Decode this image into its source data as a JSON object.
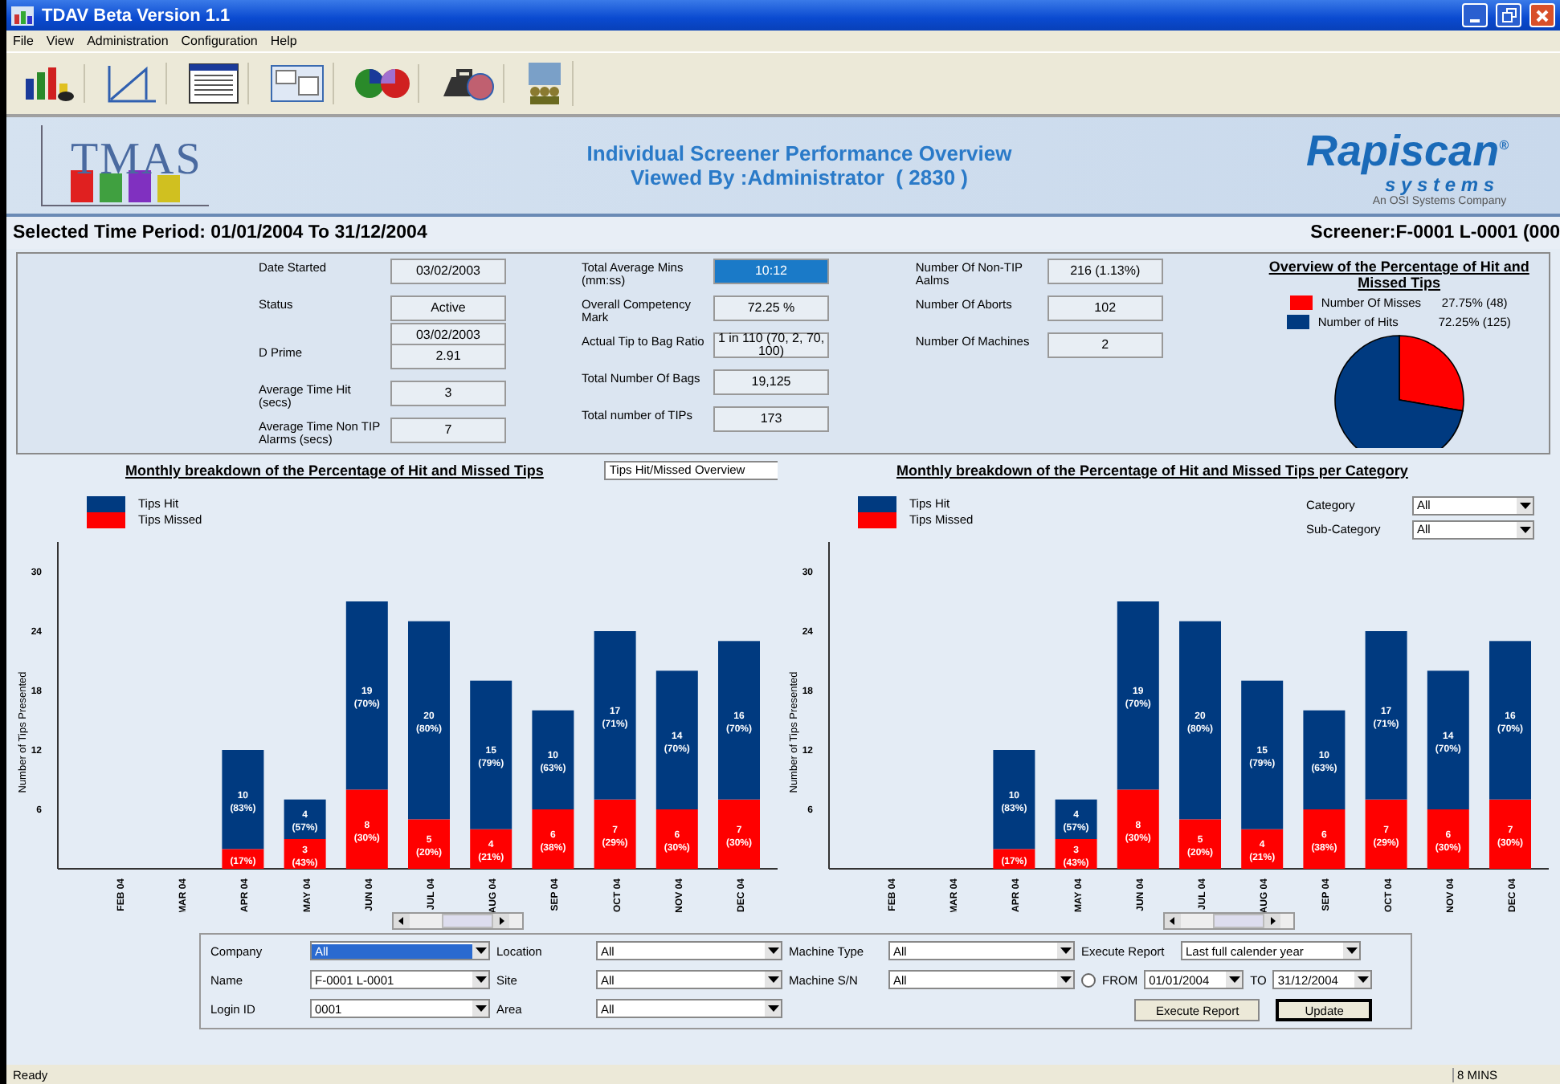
{
  "window": {
    "title": "TDAV Beta Version 1.1"
  },
  "menu": [
    "File",
    "View",
    "Administration",
    "Configuration",
    "Help"
  ],
  "banner": {
    "logo_text": "TMAS",
    "title_lines": [
      "Individual Screener Performance Overview",
      "Viewed By :Administrator  ( 2830 )"
    ],
    "brand": "Rapiscan$^{®}$",
    "brand_sub": "s y s t e m s",
    "brand_tagline": "An OSI Systems Company"
  },
  "period": "Selected Time Period: 01/01/2004 To 31/12/2004",
  "screener": "Screener:F-0001 L-0001 (000",
  "stats": [
    [
      {
        "label": "Date Started",
        "values": [
          "03/02/2003"
        ],
        "focused": false
      },
      {
        "label": "Status",
        "values": [
          "Active",
          "03/02/2003"
        ],
        "focused": false
      },
      {
        "label": "D Prime",
        "values": [
          "2.91"
        ],
        "focused": false
      },
      {
        "label": "Average Time Hit (secs)",
        "values": [
          "3"
        ],
        "focused": false
      },
      {
        "label": "Average Time Non TIP Alarms (secs)",
        "values": [
          "7"
        ],
        "focused": false
      }
    ],
    [
      {
        "label": "Total Average Mins (mm:ss)",
        "values": [
          "10:12"
        ],
        "focused": true
      },
      {
        "label": "Overall Competency Mark",
        "values": [
          "72.25 %"
        ],
        "focused": false
      },
      {
        "label": "Actual Tip to Bag Ratio",
        "values": [
          "1 in 110 (70, 2, 70, 100)"
        ],
        "focused": false
      },
      {
        "label": "Total Number Of Bags",
        "values": [
          "19,125"
        ],
        "focused": false
      },
      {
        "label": "Total number of TIPs",
        "values": [
          "173"
        ],
        "focused": false
      }
    ],
    [
      {
        "label": "Number Of Non-TIP Aalms",
        "values": [
          "216 (1.13%)"
        ],
        "focused": false
      },
      {
        "label": "Number Of Aborts",
        "values": [
          "102"
        ],
        "focused": false
      },
      {
        "label": "Number Of Machines",
        "values": [
          "2"
        ],
        "focused": false
      }
    ]
  ],
  "overview": {
    "title": "Overview of the Percentage of Hit and Missed Tips",
    "legend": [
      {
        "value": "27.75% (48)",
        "color": "#ff0000"
      },
      {
        "value": "72.25% (125)",
        "color": "#003a80"
      }
    ],
    "chart_data": {
      "type": "pie",
      "categories": [
        "Number Of Misses",
        "Number of Hits"
      ],
      "values": [
        27.75,
        72.25
      ]
    }
  },
  "charts": [
    {
      "title": "Monthly breakdown of the Percentage of Hit and Missed Tips",
      "controls": [
        {
          "kind": "select",
          "value": "Tips Hit/Missed Overview"
        }
      ],
      "bar_labels": [
        [
          "(17%)",
          "3 (43%)",
          "8 (30%)",
          "5 (20%)",
          "4 (21%)",
          "6 (38%)",
          "7 (29%)",
          "6 (30%)",
          "7 (30%)"
        ],
        [
          "10 (83%)",
          "4 (57%)",
          "19 (70%)",
          "20 (80%)",
          "15 (79%)",
          "10 (63%)",
          "17 (71%)",
          "14 (70%)",
          "16 (70%)"
        ]
      ],
      "chart_data": {
        "type": "bar",
        "stacked": true,
        "ylabel": "Number of Tips Presented",
        "categories": [
          "FEB 04",
          "MAR 04",
          "APR 04",
          "MAY 04",
          "JUN 04",
          "JUL 04",
          "AUG 04",
          "SEP 04",
          "OCT 04",
          "NOV 04",
          "DEC 04"
        ],
        "yticks": [
          6,
          12,
          18,
          24,
          30
        ],
        "ylim": [
          0,
          33
        ],
        "series": [
          {
            "name": "Tips Missed",
            "color": "#ff0000",
            "values": [
              null,
              null,
              2,
              3,
              8,
              5,
              4,
              6,
              7,
              6,
              7
            ]
          },
          {
            "name": "Tips Hit",
            "color": "#003a80",
            "values": [
              null,
              null,
              10,
              4,
              19,
              20,
              15,
              10,
              17,
              14,
              16
            ]
          }
        ]
      }
    },
    {
      "title": "Monthly breakdown of the Percentage of Hit and Missed Tips per Category",
      "controls": [
        {
          "kind": "labeled",
          "label": "Category",
          "value": "All"
        },
        {
          "kind": "labeled",
          "label": "Sub-Category",
          "value": "All"
        }
      ],
      "bar_labels": [
        [
          "(17%)",
          "3 (43%)",
          "8 (30%)",
          "5 (20%)",
          "4 (21%)",
          "6 (38%)",
          "7 (29%)",
          "6 (30%)",
          "7 (30%)"
        ],
        [
          "10 (83%)",
          "4 (57%)",
          "19 (70%)",
          "20 (80%)",
          "15 (79%)",
          "10 (63%)",
          "17 (71%)",
          "14 (70%)",
          "16 (70%)"
        ]
      ],
      "chart_data": {
        "type": "bar",
        "stacked": true,
        "ylabel": "Number of Tips Presented",
        "categories": [
          "FEB 04",
          "MAR 04",
          "APR 04",
          "MAY 04",
          "JUN 04",
          "JUL 04",
          "AUG 04",
          "SEP 04",
          "OCT 04",
          "NOV 04",
          "DEC 04"
        ],
        "yticks": [
          6,
          12,
          18,
          24,
          30
        ],
        "ylim": [
          0,
          33
        ],
        "series": [
          {
            "name": "Tips Missed",
            "color": "#ff0000",
            "values": [
              null,
              null,
              2,
              3,
              8,
              5,
              4,
              6,
              7,
              6,
              7
            ]
          },
          {
            "name": "Tips Hit",
            "color": "#003a80",
            "values": [
              null,
              null,
              10,
              4,
              19,
              20,
              15,
              10,
              17,
              14,
              16
            ]
          }
        ]
      }
    }
  ],
  "filters": [
    [
      {
        "label": "Company",
        "value": "All",
        "selected": true
      },
      {
        "label": "Name",
        "value": "F-0001 L-0001",
        "selected": false
      },
      {
        "label": "Login ID",
        "value": "0001",
        "selected": false
      }
    ],
    [
      {
        "label": "Location",
        "value": "All",
        "selected": false
      },
      {
        "label": "Site",
        "value": "All",
        "selected": false
      },
      {
        "label": "Area",
        "value": "All",
        "selected": false
      }
    ],
    [
      {
        "label": "Machine Type",
        "value": "All",
        "selected": false
      },
      {
        "label": "Machine S/N",
        "value": "All",
        "selected": false
      }
    ]
  ],
  "execute": {
    "label": "Execute Report",
    "value": "Last full calender year",
    "range": {
      "checked": false,
      "from_label": "FROM",
      "from": "01/01/2004",
      "to_label": "TO",
      "to": "31/12/2004"
    },
    "buttons": [
      {
        "label": "Execute Report",
        "default": false
      },
      {
        "label": "Update",
        "default": true
      }
    ]
  },
  "status_bar": {
    "text": "Ready",
    "timer": "8 MINS"
  }
}
